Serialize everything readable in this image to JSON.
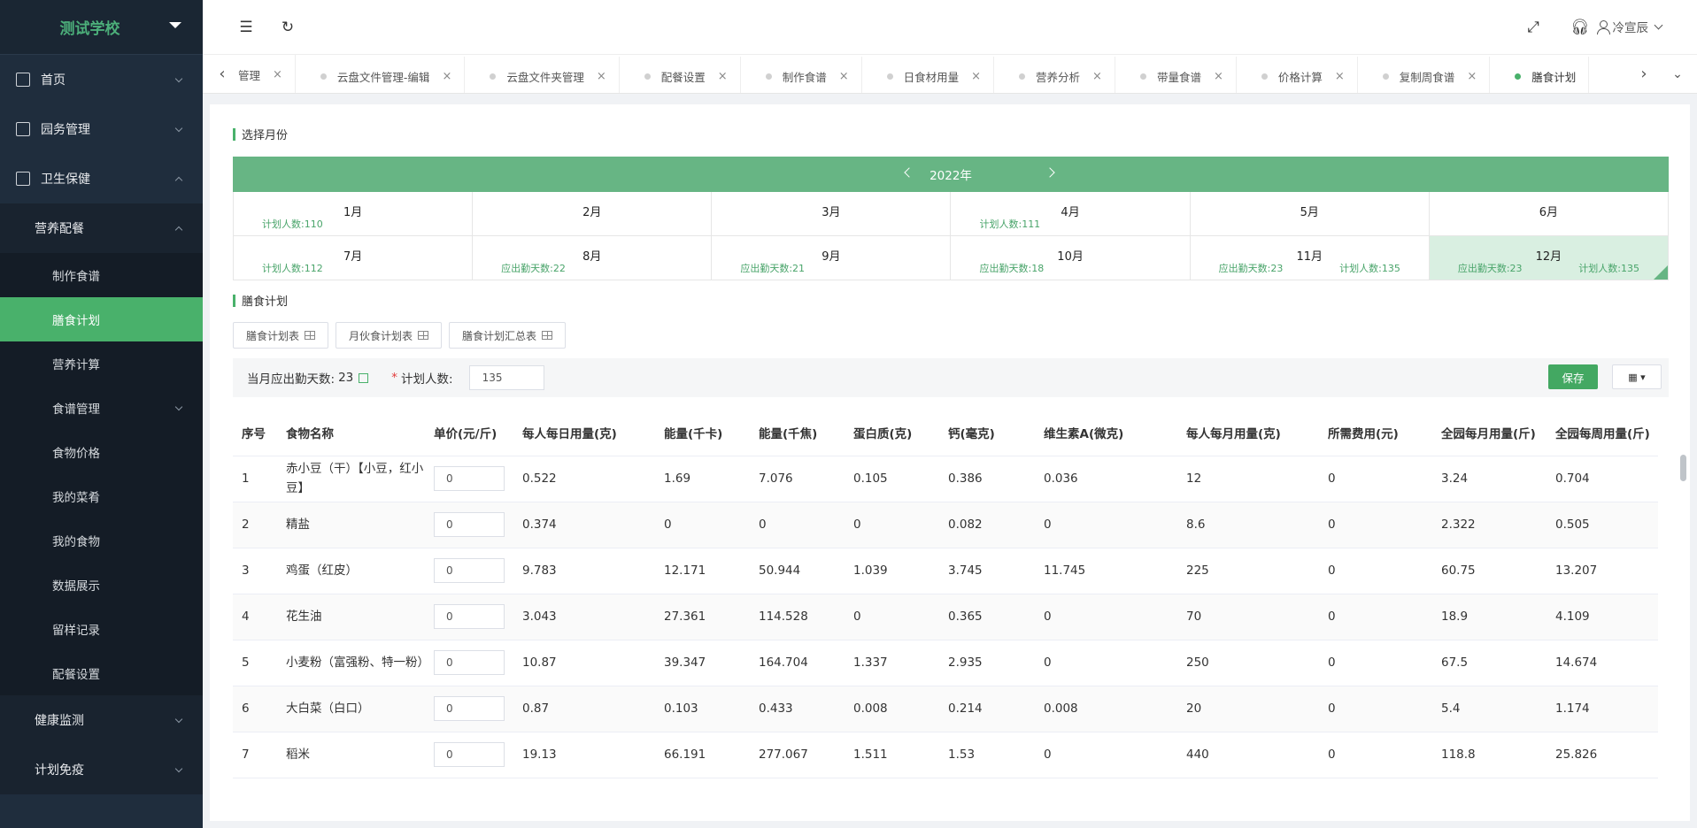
{
  "app": {
    "school_name": "测试学校",
    "user_name": "冷宣辰"
  },
  "sidebar": {
    "items": [
      {
        "label": "首页",
        "icon": "home-icon"
      },
      {
        "label": "园务管理",
        "icon": "building-icon"
      },
      {
        "label": "卫生保健",
        "icon": "health-icon"
      }
    ],
    "group_label": "营养配餐",
    "sub_items": [
      {
        "label": "制作食谱"
      },
      {
        "label": "膳食计划"
      },
      {
        "label": "营养计算"
      },
      {
        "label": "食谱管理"
      },
      {
        "label": "食物价格"
      },
      {
        "label": "我的菜肴"
      },
      {
        "label": "我的食物"
      },
      {
        "label": "数据展示"
      },
      {
        "label": "留样记录"
      },
      {
        "label": "配餐设置"
      }
    ],
    "bottom_items": [
      {
        "label": "健康监测"
      },
      {
        "label": "计划免疫"
      }
    ]
  },
  "tabs": [
    {
      "label": "管理"
    },
    {
      "label": "云盘文件管理-编辑"
    },
    {
      "label": "云盘文件夹管理"
    },
    {
      "label": "配餐设置"
    },
    {
      "label": "制作食谱"
    },
    {
      "label": "日食材用量"
    },
    {
      "label": "营养分析"
    },
    {
      "label": "带量食谱"
    },
    {
      "label": "价格计算"
    },
    {
      "label": "复制周食谱"
    },
    {
      "label": "膳食计划"
    }
  ],
  "month_section": {
    "title": "选择月份",
    "year": "2022年",
    "months": [
      {
        "label": "1月",
        "left": "计划人数:110",
        "right": ""
      },
      {
        "label": "2月",
        "left": "",
        "right": ""
      },
      {
        "label": "3月",
        "left": "",
        "right": ""
      },
      {
        "label": "4月",
        "left": "计划人数:111",
        "right": ""
      },
      {
        "label": "5月",
        "left": "",
        "right": ""
      },
      {
        "label": "6月",
        "left": "",
        "right": ""
      },
      {
        "label": "7月",
        "left": "计划人数:112",
        "right": ""
      },
      {
        "label": "8月",
        "left": "应出勤天数:22",
        "right": ""
      },
      {
        "label": "9月",
        "left": "应出勤天数:21",
        "right": ""
      },
      {
        "label": "10月",
        "left": "应出勤天数:18",
        "right": ""
      },
      {
        "label": "11月",
        "left": "应出勤天数:23",
        "right": "计划人数:135"
      },
      {
        "label": "12月",
        "left": "应出勤天数:23",
        "right": "计划人数:135"
      }
    ]
  },
  "plan_section": {
    "title": "膳食计划",
    "buttons": [
      "膳食计划表",
      "月伙食计划表",
      "膳食计划汇总表"
    ],
    "work_days_label": "当月应出勤天数:",
    "work_days_value": "23",
    "required_mark": "*",
    "plan_people_label": "计划人数:",
    "plan_people_value": "135",
    "save_label": "保存"
  },
  "table": {
    "columns": [
      "序号",
      "食物名称",
      "单价(元/斤)",
      "每人每日用量(克)",
      "能量(千卡)",
      "能量(千焦)",
      "蛋白质(克)",
      "钙(毫克)",
      "维生素A(微克)",
      "每人每月用量(克)",
      "所需费用(元)",
      "全园每月用量(斤)",
      "全园每周用量(斤)"
    ],
    "rows": [
      {
        "no": "1",
        "name": "赤小豆（干）【小豆，红小豆】",
        "price": "0",
        "daily": "0.522",
        "kcal": "1.69",
        "kj": "7.076",
        "protein": "0.105",
        "ca": "0.386",
        "va": "0.036",
        "monthly": "12",
        "cost": "0",
        "park_month": "3.24",
        "park_week": "0.704"
      },
      {
        "no": "2",
        "name": "精盐",
        "price": "0",
        "daily": "0.374",
        "kcal": "0",
        "kj": "0",
        "protein": "0",
        "ca": "0.082",
        "va": "0",
        "monthly": "8.6",
        "cost": "0",
        "park_month": "2.322",
        "park_week": "0.505"
      },
      {
        "no": "3",
        "name": "鸡蛋（红皮）",
        "price": "0",
        "daily": "9.783",
        "kcal": "12.171",
        "kj": "50.944",
        "protein": "1.039",
        "ca": "3.745",
        "va": "11.745",
        "monthly": "225",
        "cost": "0",
        "park_month": "60.75",
        "park_week": "13.207"
      },
      {
        "no": "4",
        "name": "花生油",
        "price": "0",
        "daily": "3.043",
        "kcal": "27.361",
        "kj": "114.528",
        "protein": "0",
        "ca": "0.365",
        "va": "0",
        "monthly": "70",
        "cost": "0",
        "park_month": "18.9",
        "park_week": "4.109"
      },
      {
        "no": "5",
        "name": "小麦粉（富强粉、特一粉）",
        "price": "0",
        "daily": "10.87",
        "kcal": "39.347",
        "kj": "164.704",
        "protein": "1.337",
        "ca": "2.935",
        "va": "0",
        "monthly": "250",
        "cost": "0",
        "park_month": "67.5",
        "park_week": "14.674"
      },
      {
        "no": "6",
        "name": "大白菜（白口）",
        "price": "0",
        "daily": "0.87",
        "kcal": "0.103",
        "kj": "0.433",
        "protein": "0.008",
        "ca": "0.214",
        "va": "0.008",
        "monthly": "20",
        "cost": "0",
        "park_month": "5.4",
        "park_week": "1.174"
      },
      {
        "no": "7",
        "name": "稻米",
        "price": "0",
        "daily": "19.13",
        "kcal": "66.191",
        "kj": "277.067",
        "protein": "1.511",
        "ca": "1.53",
        "va": "0",
        "monthly": "440",
        "cost": "0",
        "park_month": "118.8",
        "park_week": "25.826"
      }
    ]
  }
}
